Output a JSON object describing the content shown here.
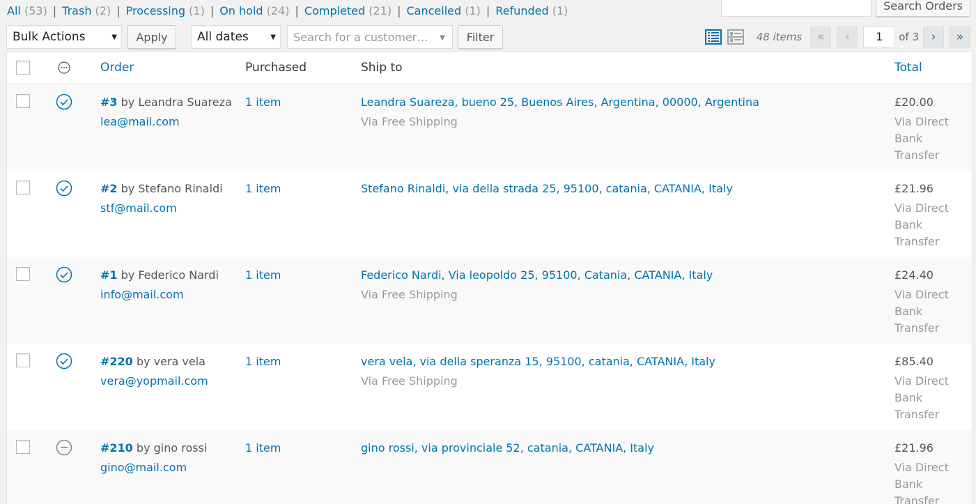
{
  "status_filters": [
    {
      "label": "All",
      "count": "(53)"
    },
    {
      "label": "Trash",
      "count": "(2)"
    },
    {
      "label": "Processing",
      "count": "(1)"
    },
    {
      "label": "On hold",
      "count": "(24)"
    },
    {
      "label": "Completed",
      "count": "(21)"
    },
    {
      "label": "Cancelled",
      "count": "(1)"
    },
    {
      "label": "Refunded",
      "count": "(1)"
    }
  ],
  "search": {
    "value": "",
    "button_label": "Search Orders"
  },
  "toolbar": {
    "bulk_actions": "Bulk Actions",
    "apply_label": "Apply",
    "dates": "All dates",
    "customer_placeholder": "Search for a customer…",
    "filter_label": "Filter",
    "items_count": "48 items",
    "first_label": "«",
    "prev_label": "‹",
    "current_page": "1",
    "of_pages": "of 3",
    "next_label": "›",
    "last_label": "»"
  },
  "columns": {
    "status": "",
    "order": "Order",
    "purchased": "Purchased",
    "ship_to": "Ship to",
    "total": "Total"
  },
  "orders": [
    {
      "number": "#3",
      "by": "by Leandra Suareza",
      "email": "lea@mail.com",
      "purchased": "1 item",
      "ship_to": "Leandra Suareza, bueno 25, Buenos Aires, Argentina, 00000, Argentina",
      "shipping_method": "Via Free Shipping",
      "total": "£20.00",
      "payment": "Via Direct Bank Transfer",
      "status_icon": "check-circle-icon"
    },
    {
      "number": "#2",
      "by": "by Stefano Rinaldi",
      "email": "stf@mail.com",
      "purchased": "1 item",
      "ship_to": "Stefano Rinaldi, via della strada 25, 95100, catania, CATANIA, Italy",
      "shipping_method": "",
      "total": "£21.96",
      "payment": "Via Direct Bank Transfer",
      "status_icon": "check-circle-icon"
    },
    {
      "number": "#1",
      "by": "by Federico Nardi",
      "email": "info@mail.com",
      "purchased": "1 item",
      "ship_to": "Federico Nardi, Via leopoldo 25, 95100, Catania, CATANIA, Italy",
      "shipping_method": "Via Free Shipping",
      "total": "£24.40",
      "payment": "Via Direct Bank Transfer",
      "status_icon": "check-circle-icon"
    },
    {
      "number": "#220",
      "by": "by vera vela",
      "email": "vera@yopmail.com",
      "purchased": "1 item",
      "ship_to": "vera vela, via della speranza 15, 95100, catania, CATANIA, Italy",
      "shipping_method": "Via Free Shipping",
      "total": "£85.40",
      "payment": "Via Direct Bank Transfer",
      "status_icon": "check-circle-icon"
    },
    {
      "number": "#210",
      "by": "by gino rossi",
      "email": "gino@mail.com",
      "purchased": "1 item",
      "ship_to": "gino rossi, via provinciale 52, catania, CATANIA, Italy",
      "shipping_method": "",
      "total": "£21.96",
      "payment": "Via Direct Bank Transfer",
      "status_icon": "minus-circle-icon"
    }
  ],
  "colors": {
    "link": "#0073aa",
    "muted": "#999999",
    "status_ok": "#0073aa",
    "status_cancelled": "#888888"
  }
}
